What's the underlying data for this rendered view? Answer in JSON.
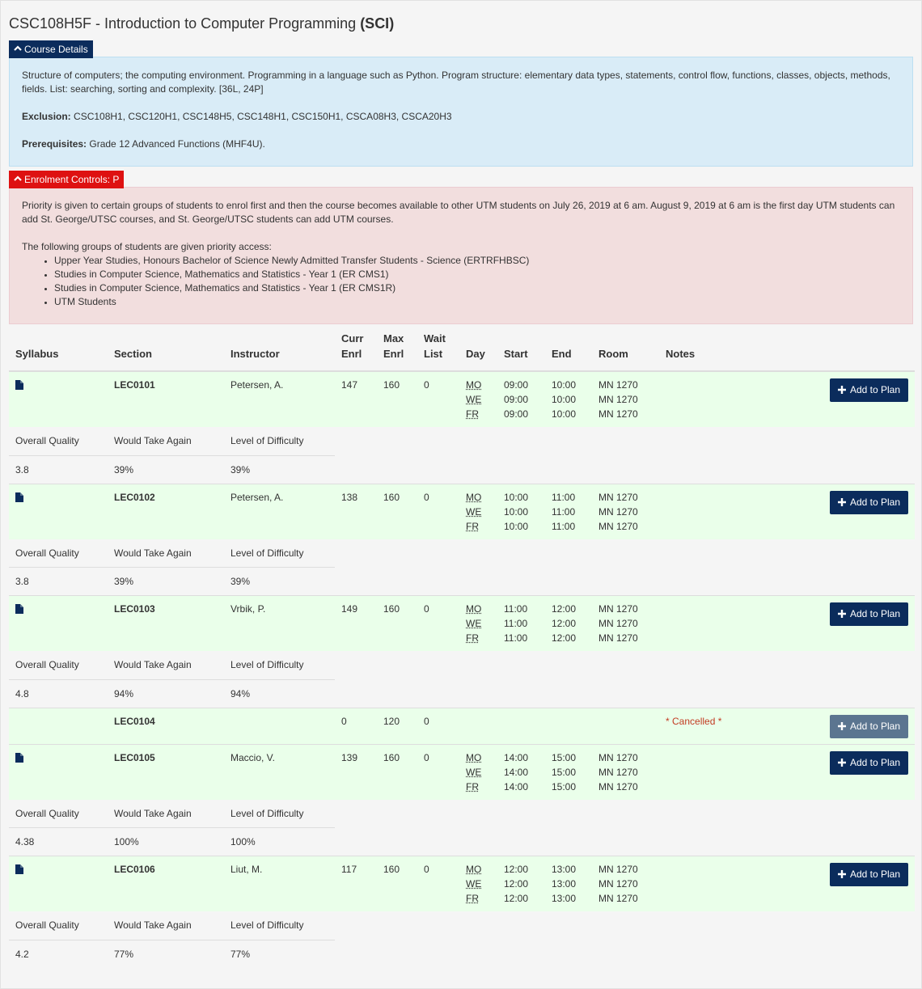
{
  "course": {
    "code_title": "CSC108H5F - Introduction to Computer Programming ",
    "campus": "(SCI)"
  },
  "details": {
    "toggle_label": "Course Details",
    "description": "Structure of computers; the computing environment. Programming in a language such as Python. Program structure: elementary data types, statements, control flow, functions, classes, objects, methods, fields. List: searching, sorting and complexity. [36L, 24P]",
    "exclusion_label": "Exclusion:",
    "exclusion_value": " CSC108H1, CSC120H1, CSC148H5, CSC148H1, CSC150H1, CSCA08H3, CSCA20H3",
    "prereq_label": "Prerequisites:",
    "prereq_value": " Grade 12 Advanced Functions (MHF4U)."
  },
  "enrolment": {
    "toggle_label": "Enrolment Controls: P",
    "text": "Priority is given to certain groups of students to enrol first and then the course becomes available to other UTM students on July 26, 2019 at 6 am. August 9, 2019 at 6 am is the first day UTM students can add St. George/UTSC courses, and St. George/UTSC students can add UTM courses.",
    "groups_intro": "The following groups of students are given priority access:",
    "groups": [
      "Upper Year Studies, Honours Bachelor of Science Newly Admitted Transfer Students - Science (ERTRFHBSC)",
      "Studies in Computer Science, Mathematics and Statistics - Year 1 (ER CMS1)",
      "Studies in Computer Science, Mathematics and Statistics - Year 1 (ER CMS1R)",
      "UTM Students"
    ]
  },
  "table": {
    "headers": {
      "syllabus": "Syllabus",
      "section": "Section",
      "instructor": "Instructor",
      "curr1": "Curr",
      "curr2": "Enrl",
      "max1": "Max",
      "max2": "Enrl",
      "wait1": "Wait",
      "wait2": "List",
      "day": "Day",
      "start": "Start",
      "end": "End",
      "room": "Room",
      "notes": "Notes"
    },
    "rating_labels": {
      "quality": "Overall Quality",
      "again": "Would Take Again",
      "difficulty": "Level of Difficulty"
    },
    "add_label": "Add to Plan",
    "sections": [
      {
        "section": "LEC0101",
        "instructor": "Petersen, A.",
        "curr": "147",
        "max": "160",
        "wait": "0",
        "days": [
          "MO",
          "WE",
          "FR"
        ],
        "starts": [
          "09:00",
          "09:00",
          "09:00"
        ],
        "ends": [
          "10:00",
          "10:00",
          "10:00"
        ],
        "rooms": [
          "MN 1270",
          "MN 1270",
          "MN 1270"
        ],
        "note": "",
        "quality": "3.8",
        "again": "39%",
        "difficulty": "39%"
      },
      {
        "section": "LEC0102",
        "instructor": "Petersen, A.",
        "curr": "138",
        "max": "160",
        "wait": "0",
        "days": [
          "MO",
          "WE",
          "FR"
        ],
        "starts": [
          "10:00",
          "10:00",
          "10:00"
        ],
        "ends": [
          "11:00",
          "11:00",
          "11:00"
        ],
        "rooms": [
          "MN 1270",
          "MN 1270",
          "MN 1270"
        ],
        "note": "",
        "quality": "3.8",
        "again": "39%",
        "difficulty": "39%"
      },
      {
        "section": "LEC0103",
        "instructor": "Vrbik, P.",
        "curr": "149",
        "max": "160",
        "wait": "0",
        "days": [
          "MO",
          "WE",
          "FR"
        ],
        "starts": [
          "11:00",
          "11:00",
          "11:00"
        ],
        "ends": [
          "12:00",
          "12:00",
          "12:00"
        ],
        "rooms": [
          "MN 1270",
          "MN 1270",
          "MN 1270"
        ],
        "note": "",
        "quality": "4.8",
        "again": "94%",
        "difficulty": "94%"
      },
      {
        "section": "LEC0104",
        "instructor": "",
        "curr": "0",
        "max": "120",
        "wait": "0",
        "days": [],
        "starts": [],
        "ends": [],
        "rooms": [],
        "note": "* Cancelled *",
        "cancelled": true
      },
      {
        "section": "LEC0105",
        "instructor": "Maccio, V.",
        "curr": "139",
        "max": "160",
        "wait": "0",
        "days": [
          "MO",
          "WE",
          "FR"
        ],
        "starts": [
          "14:00",
          "14:00",
          "14:00"
        ],
        "ends": [
          "15:00",
          "15:00",
          "15:00"
        ],
        "rooms": [
          "MN 1270",
          "MN 1270",
          "MN 1270"
        ],
        "note": "",
        "quality": "4.38",
        "again": "100%",
        "difficulty": "100%"
      },
      {
        "section": "LEC0106",
        "instructor": "Liut, M.",
        "curr": "117",
        "max": "160",
        "wait": "0",
        "days": [
          "MO",
          "WE",
          "FR"
        ],
        "starts": [
          "12:00",
          "12:00",
          "12:00"
        ],
        "ends": [
          "13:00",
          "13:00",
          "13:00"
        ],
        "rooms": [
          "MN 1270",
          "MN 1270",
          "MN 1270"
        ],
        "note": "",
        "quality": "4.2",
        "again": "77%",
        "difficulty": "77%"
      }
    ]
  },
  "colors": {
    "navy": "#0b2c5c",
    "red": "#de1111",
    "section_row_bg": "#eaffea",
    "cancel_text": "#c23b22"
  },
  "icons": {
    "syllabus": "document-icon",
    "toggle": "chevron-up-icon",
    "add": "plus-icon"
  }
}
